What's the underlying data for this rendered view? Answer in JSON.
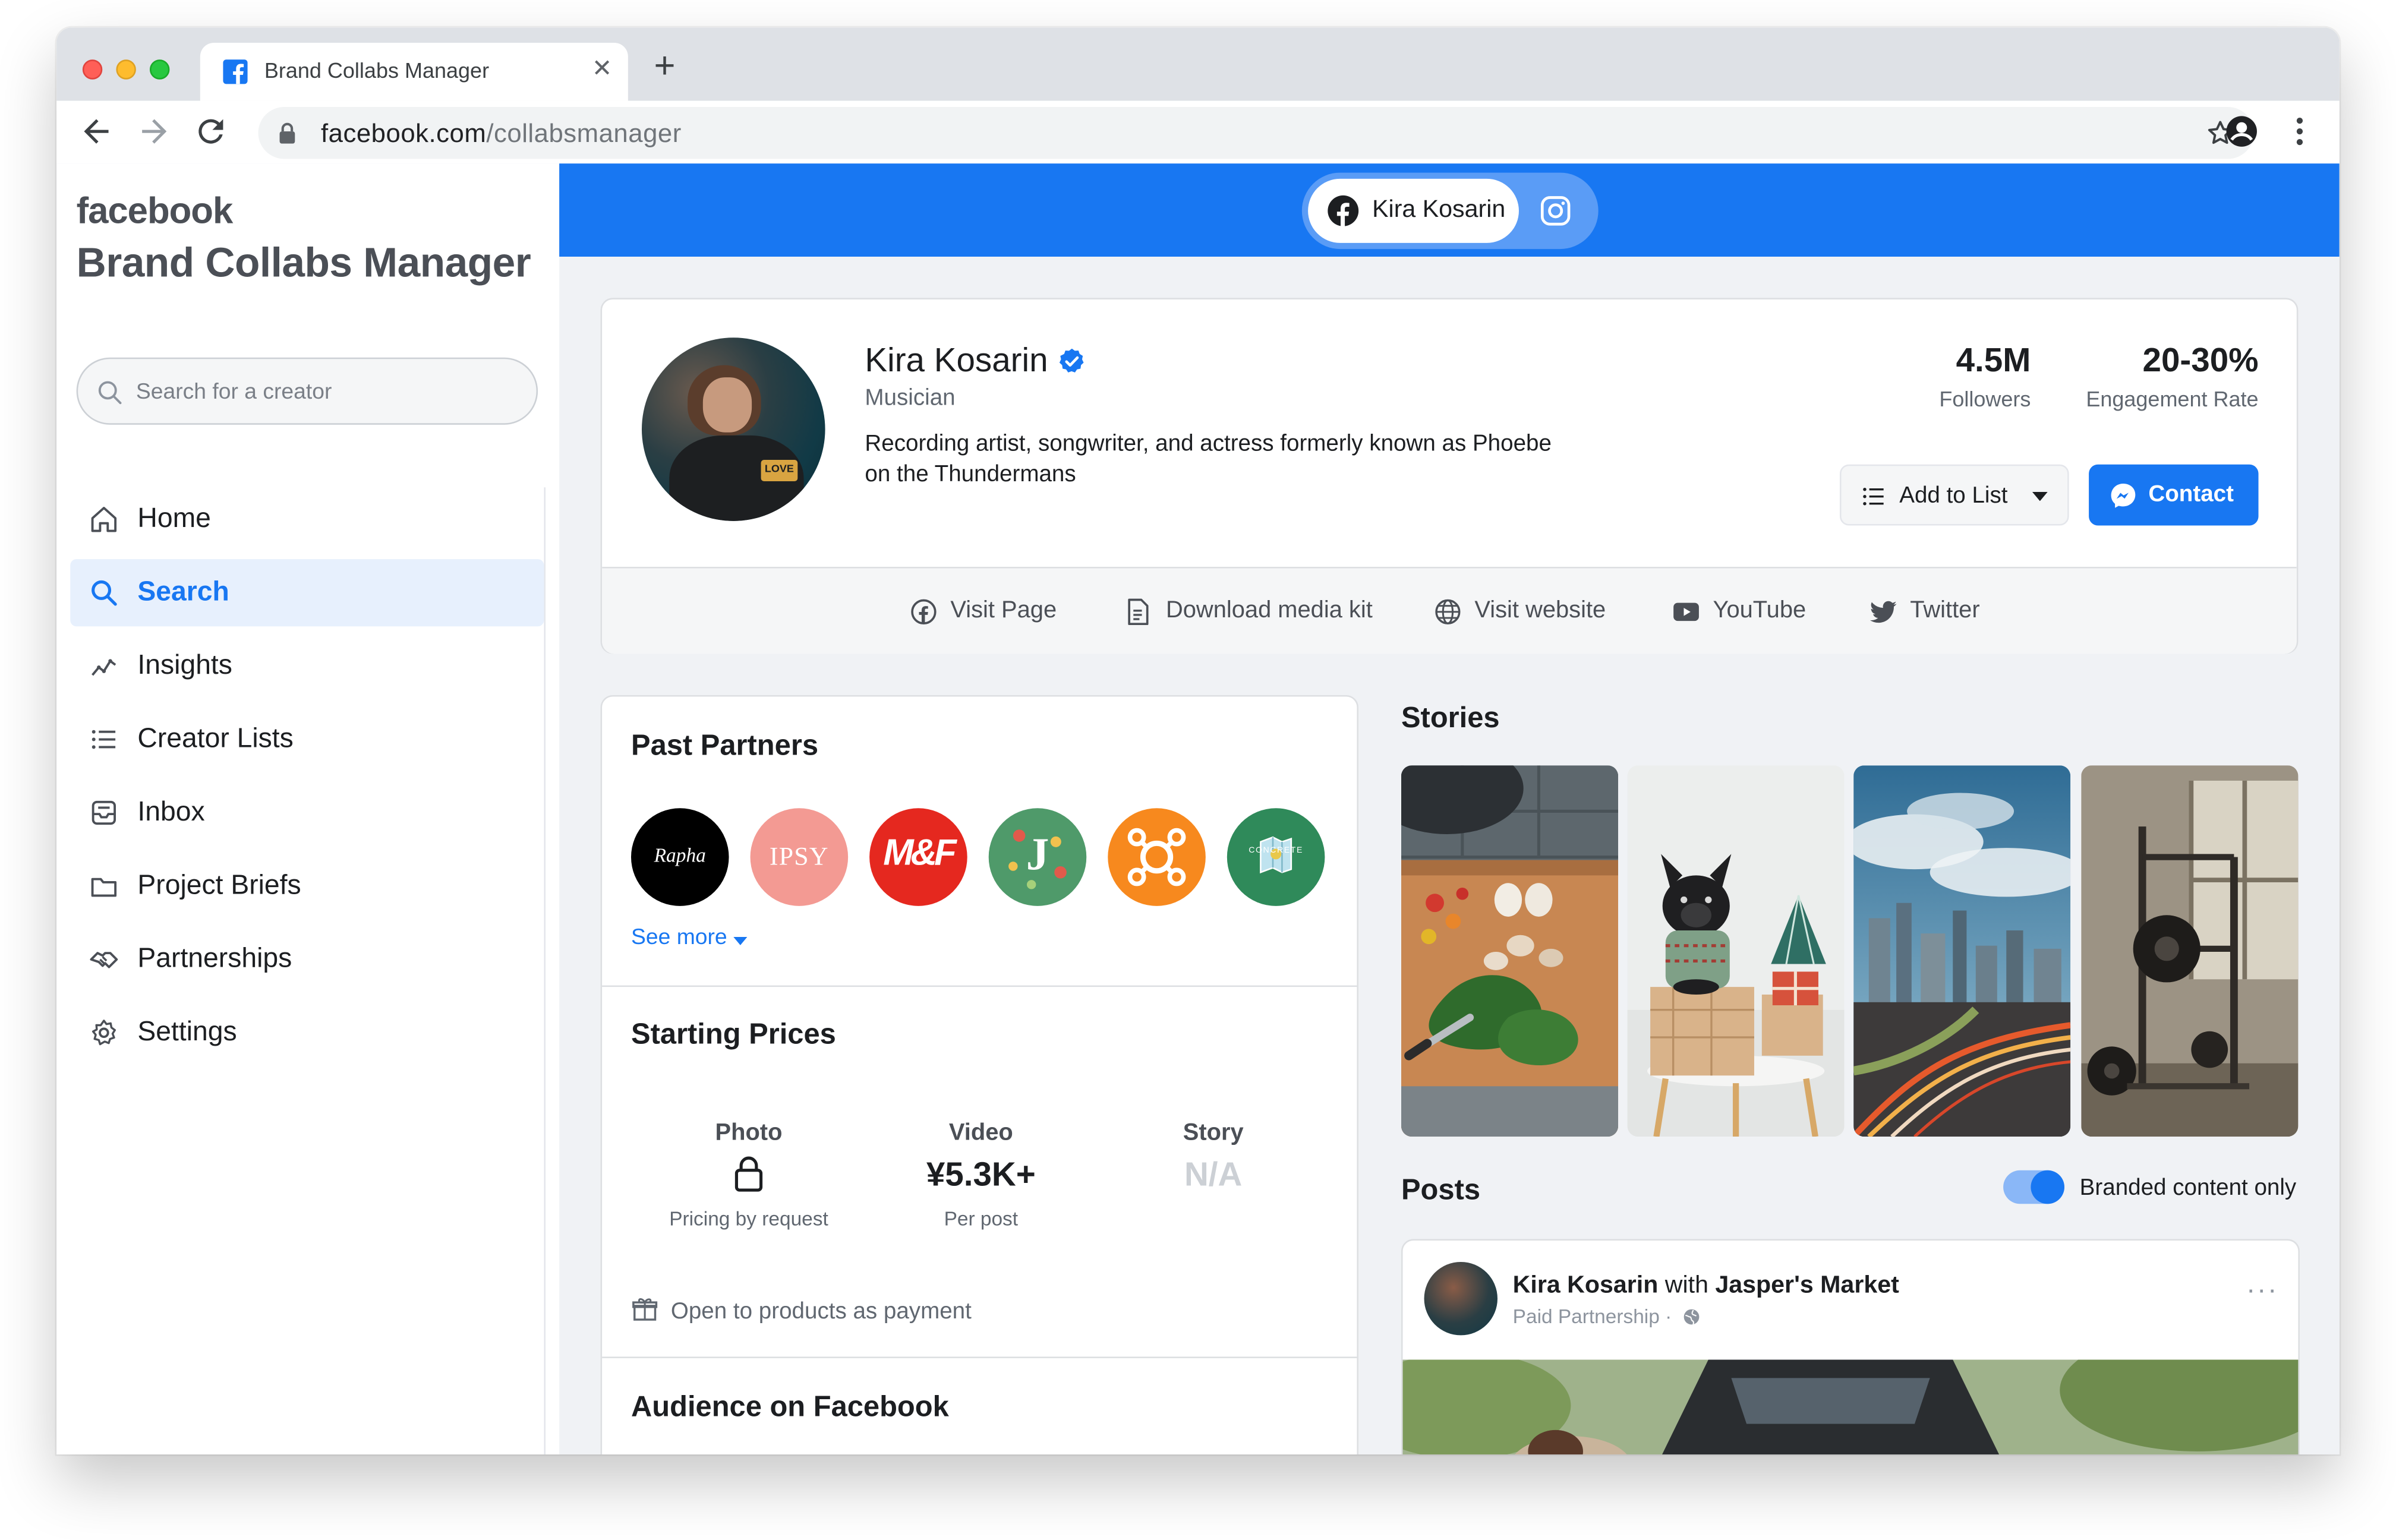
{
  "browser": {
    "tab_title": "Brand Collabs Manager",
    "url_host": "facebook.com",
    "url_path": "/collabsmanager"
  },
  "sidebar": {
    "brand": "facebook",
    "title": "Brand Collabs Manager",
    "search_placeholder": "Search for a creator",
    "items": [
      {
        "label": "Home",
        "icon": "home-icon",
        "active": false
      },
      {
        "label": "Search",
        "icon": "search-icon",
        "active": true
      },
      {
        "label": "Insights",
        "icon": "insights-icon",
        "active": false
      },
      {
        "label": "Creator Lists",
        "icon": "list-icon",
        "active": false
      },
      {
        "label": "Inbox",
        "icon": "inbox-icon",
        "active": false
      },
      {
        "label": "Project Briefs",
        "icon": "folder-icon",
        "active": false
      },
      {
        "label": "Partnerships",
        "icon": "handshake-icon",
        "active": false
      },
      {
        "label": "Settings",
        "icon": "gear-icon",
        "active": false
      }
    ]
  },
  "switcher": {
    "facebook_label": "Kira Kosarin"
  },
  "profile": {
    "name": "Kira Kosarin",
    "role": "Musician",
    "bio": "Recording artist, songwriter, and actress formerly known as Phoebe on the Thundermans",
    "followers_value": "4.5M",
    "followers_label": "Followers",
    "engagement_value": "20-30%",
    "engagement_label": "Engagement Rate",
    "add_to_list_label": "Add to List",
    "contact_label": "Contact",
    "avatar_patch_text": "LOVE"
  },
  "links": [
    {
      "label": "Visit Page",
      "icon": "facebook-circle-icon"
    },
    {
      "label": "Download media kit",
      "icon": "document-icon"
    },
    {
      "label": "Visit website",
      "icon": "globe-icon"
    },
    {
      "label": "YouTube",
      "icon": "youtube-icon"
    },
    {
      "label": "Twitter",
      "icon": "twitter-icon"
    }
  ],
  "past_partners": {
    "title": "Past Partners",
    "see_more": "See more",
    "logos": [
      {
        "text": "Rapha",
        "bg": "#000000",
        "fg": "#ffffff"
      },
      {
        "text": "IPSY",
        "bg": "#f39a93",
        "fg": "#ffffff"
      },
      {
        "text": "M&F",
        "bg": "#e5281f",
        "fg": "#ffffff"
      },
      {
        "text": "J",
        "bg": "#4f9a6a",
        "fg": "#ffffff"
      },
      {
        "text": "",
        "bg": "#f7891e",
        "fg": "#ffffff"
      },
      {
        "text": "CONCRETE JUNGLE",
        "bg": "#2f8a5a",
        "fg": "#ffffff"
      }
    ]
  },
  "starting_prices": {
    "title": "Starting Prices",
    "photo_head": "Photo",
    "photo_sub": "Pricing by request",
    "video_head": "Video",
    "video_value": "¥5.3K+",
    "video_sub": "Per post",
    "story_head": "Story",
    "story_value": "N/A",
    "open_products": "Open to products as payment"
  },
  "audience": {
    "title": "Audience on Facebook"
  },
  "stories": {
    "title": "Stories"
  },
  "posts": {
    "title": "Posts",
    "toggle_label": "Branded content only",
    "toggle_on": true,
    "author": "Kira Kosarin",
    "with_word": "with",
    "partner": "Jasper's Market",
    "meta": "Paid Partnership ·"
  },
  "colors": {
    "facebook_blue": "#1877f2",
    "page_bg": "#f0f2f5"
  }
}
